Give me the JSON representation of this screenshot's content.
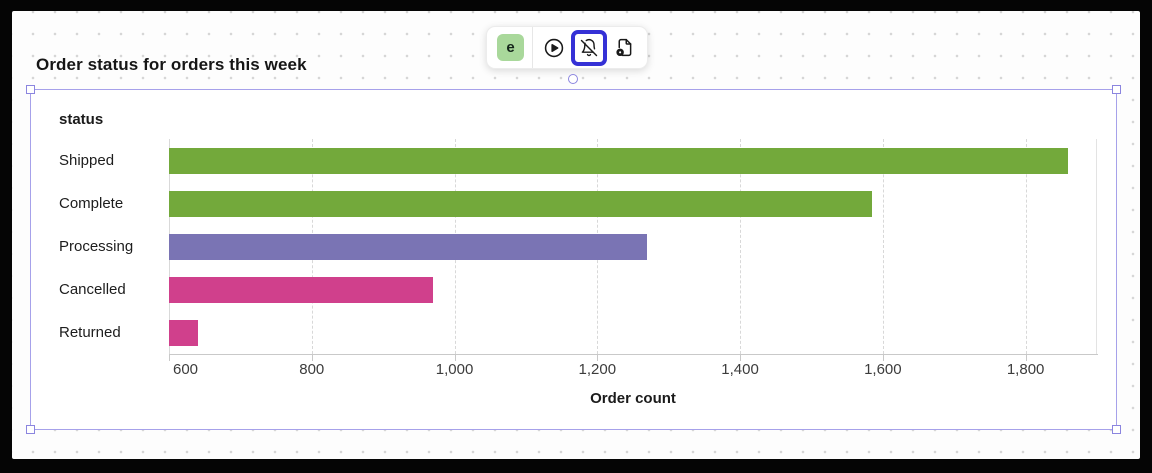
{
  "title": "Order status for orders this week",
  "toolbar": {
    "logo_label": "e",
    "buttons": [
      {
        "name": "run-query",
        "icon": "play-circle-icon",
        "active": false
      },
      {
        "name": "notifications-off",
        "icon": "bell-slash-icon",
        "active": true
      },
      {
        "name": "file-action",
        "icon": "file-action-icon",
        "active": false
      }
    ]
  },
  "chart_data": {
    "type": "bar",
    "orientation": "horizontal",
    "title": "Order status for orders this week",
    "ylabel": "status",
    "xlabel": "Order count",
    "categories": [
      "Shipped",
      "Complete",
      "Processing",
      "Cancelled",
      "Returned"
    ],
    "values": [
      1860,
      1585,
      1270,
      970,
      640
    ],
    "bar_colors": [
      "#73a93b",
      "#73a93b",
      "#7a74b4",
      "#d0408c",
      "#d0408c"
    ],
    "xlim": [
      600,
      1900
    ],
    "xticks": [
      600,
      800,
      1000,
      1200,
      1400,
      1600,
      1800
    ],
    "xtick_labels": [
      "600",
      "800",
      "1,000",
      "1,200",
      "1,400",
      "1,600",
      "1,800"
    ],
    "grid": "dashed-vertical",
    "legend": false
  },
  "colors": {
    "accent_blue": "#3531d6",
    "selection_purple": "#a6a1ea",
    "handle_purple": "#8b85df",
    "badge_green_bg": "#a9d89b",
    "bar_green": "#73a93b",
    "bar_purple": "#7a74b4",
    "bar_pink": "#d0408c"
  }
}
